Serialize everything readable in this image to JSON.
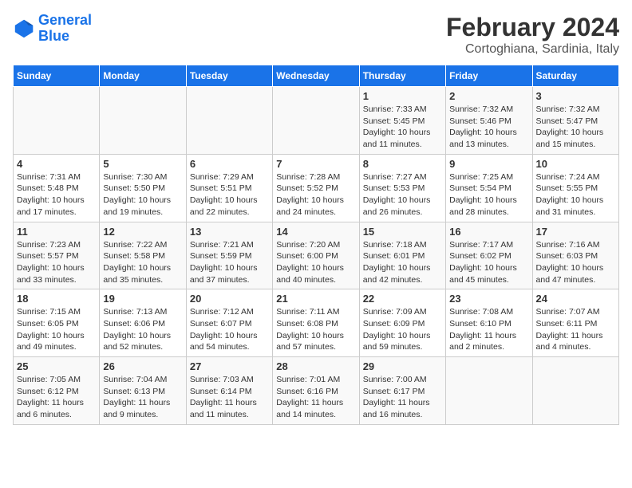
{
  "logo": {
    "line1": "General",
    "line2": "Blue"
  },
  "title": "February 2024",
  "subtitle": "Cortoghiana, Sardinia, Italy",
  "days_of_week": [
    "Sunday",
    "Monday",
    "Tuesday",
    "Wednesday",
    "Thursday",
    "Friday",
    "Saturday"
  ],
  "weeks": [
    [
      {
        "day": "",
        "info": ""
      },
      {
        "day": "",
        "info": ""
      },
      {
        "day": "",
        "info": ""
      },
      {
        "day": "",
        "info": ""
      },
      {
        "day": "1",
        "info": "Sunrise: 7:33 AM\nSunset: 5:45 PM\nDaylight: 10 hours and 11 minutes."
      },
      {
        "day": "2",
        "info": "Sunrise: 7:32 AM\nSunset: 5:46 PM\nDaylight: 10 hours and 13 minutes."
      },
      {
        "day": "3",
        "info": "Sunrise: 7:32 AM\nSunset: 5:47 PM\nDaylight: 10 hours and 15 minutes."
      }
    ],
    [
      {
        "day": "4",
        "info": "Sunrise: 7:31 AM\nSunset: 5:48 PM\nDaylight: 10 hours and 17 minutes."
      },
      {
        "day": "5",
        "info": "Sunrise: 7:30 AM\nSunset: 5:50 PM\nDaylight: 10 hours and 19 minutes."
      },
      {
        "day": "6",
        "info": "Sunrise: 7:29 AM\nSunset: 5:51 PM\nDaylight: 10 hours and 22 minutes."
      },
      {
        "day": "7",
        "info": "Sunrise: 7:28 AM\nSunset: 5:52 PM\nDaylight: 10 hours and 24 minutes."
      },
      {
        "day": "8",
        "info": "Sunrise: 7:27 AM\nSunset: 5:53 PM\nDaylight: 10 hours and 26 minutes."
      },
      {
        "day": "9",
        "info": "Sunrise: 7:25 AM\nSunset: 5:54 PM\nDaylight: 10 hours and 28 minutes."
      },
      {
        "day": "10",
        "info": "Sunrise: 7:24 AM\nSunset: 5:55 PM\nDaylight: 10 hours and 31 minutes."
      }
    ],
    [
      {
        "day": "11",
        "info": "Sunrise: 7:23 AM\nSunset: 5:57 PM\nDaylight: 10 hours and 33 minutes."
      },
      {
        "day": "12",
        "info": "Sunrise: 7:22 AM\nSunset: 5:58 PM\nDaylight: 10 hours and 35 minutes."
      },
      {
        "day": "13",
        "info": "Sunrise: 7:21 AM\nSunset: 5:59 PM\nDaylight: 10 hours and 37 minutes."
      },
      {
        "day": "14",
        "info": "Sunrise: 7:20 AM\nSunset: 6:00 PM\nDaylight: 10 hours and 40 minutes."
      },
      {
        "day": "15",
        "info": "Sunrise: 7:18 AM\nSunset: 6:01 PM\nDaylight: 10 hours and 42 minutes."
      },
      {
        "day": "16",
        "info": "Sunrise: 7:17 AM\nSunset: 6:02 PM\nDaylight: 10 hours and 45 minutes."
      },
      {
        "day": "17",
        "info": "Sunrise: 7:16 AM\nSunset: 6:03 PM\nDaylight: 10 hours and 47 minutes."
      }
    ],
    [
      {
        "day": "18",
        "info": "Sunrise: 7:15 AM\nSunset: 6:05 PM\nDaylight: 10 hours and 49 minutes."
      },
      {
        "day": "19",
        "info": "Sunrise: 7:13 AM\nSunset: 6:06 PM\nDaylight: 10 hours and 52 minutes."
      },
      {
        "day": "20",
        "info": "Sunrise: 7:12 AM\nSunset: 6:07 PM\nDaylight: 10 hours and 54 minutes."
      },
      {
        "day": "21",
        "info": "Sunrise: 7:11 AM\nSunset: 6:08 PM\nDaylight: 10 hours and 57 minutes."
      },
      {
        "day": "22",
        "info": "Sunrise: 7:09 AM\nSunset: 6:09 PM\nDaylight: 10 hours and 59 minutes."
      },
      {
        "day": "23",
        "info": "Sunrise: 7:08 AM\nSunset: 6:10 PM\nDaylight: 11 hours and 2 minutes."
      },
      {
        "day": "24",
        "info": "Sunrise: 7:07 AM\nSunset: 6:11 PM\nDaylight: 11 hours and 4 minutes."
      }
    ],
    [
      {
        "day": "25",
        "info": "Sunrise: 7:05 AM\nSunset: 6:12 PM\nDaylight: 11 hours and 6 minutes."
      },
      {
        "day": "26",
        "info": "Sunrise: 7:04 AM\nSunset: 6:13 PM\nDaylight: 11 hours and 9 minutes."
      },
      {
        "day": "27",
        "info": "Sunrise: 7:03 AM\nSunset: 6:14 PM\nDaylight: 11 hours and 11 minutes."
      },
      {
        "day": "28",
        "info": "Sunrise: 7:01 AM\nSunset: 6:16 PM\nDaylight: 11 hours and 14 minutes."
      },
      {
        "day": "29",
        "info": "Sunrise: 7:00 AM\nSunset: 6:17 PM\nDaylight: 11 hours and 16 minutes."
      },
      {
        "day": "",
        "info": ""
      },
      {
        "day": "",
        "info": ""
      }
    ]
  ]
}
